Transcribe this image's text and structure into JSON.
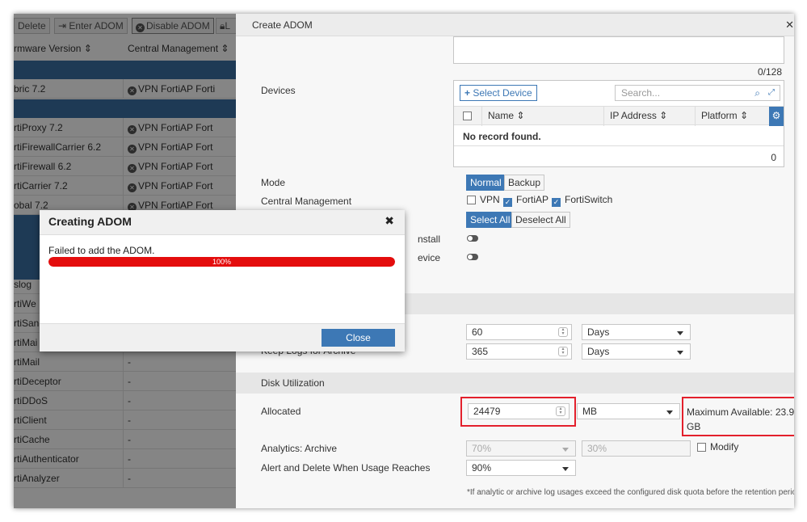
{
  "toolbar": {
    "delete": "Delete",
    "enter_adom": "Enter ADOM",
    "disable_adom": "Disable ADOM",
    "extra": "L"
  },
  "list": {
    "col_firmware": "rmware Version ⇕",
    "col_central": "Central Management ⇕",
    "rows": [
      {
        "name": "bric 7.2",
        "cm": "VPN  FortiAP  Forti"
      },
      {
        "name": "rtiProxy 7.2",
        "cm": "VPN  FortiAP  Fort"
      },
      {
        "name": "rtiFirewallCarrier 6.2",
        "cm": "VPN  FortiAP  Fort"
      },
      {
        "name": "rtiFirewall 6.2",
        "cm": "VPN  FortiAP  Fort"
      },
      {
        "name": "rtiCarrier 7.2",
        "cm": "VPN  FortiAP  Fort"
      },
      {
        "name": "obal 7.2",
        "cm": "VPN  FortiAP  Fort"
      },
      {
        "name": "slog",
        "cm": ""
      },
      {
        "name": "rtiWe",
        "cm": ""
      },
      {
        "name": "rtiSan",
        "cm": ""
      },
      {
        "name": "rtiMai",
        "cm": ""
      },
      {
        "name": "rtiMail",
        "cm": "-"
      },
      {
        "name": "rtiDeceptor",
        "cm": "-"
      },
      {
        "name": "rtiDDoS",
        "cm": "-"
      },
      {
        "name": "rtiClient",
        "cm": "-"
      },
      {
        "name": "rtiCache",
        "cm": "-"
      },
      {
        "name": "rtiAuthenticator",
        "cm": "-"
      },
      {
        "name": "rtiAnalyzer",
        "cm": "-"
      }
    ]
  },
  "panel": {
    "title": "Create ADOM",
    "char_count": "0/128",
    "devices_label": "Devices",
    "select_device": "Select Device",
    "search_placeholder": "Search...",
    "table_cols": [
      "Name ⇕",
      "IP Address ⇕",
      "Platform ⇕"
    ],
    "no_record": "No record found.",
    "record_count": "0",
    "mode_label": "Mode",
    "mode_normal": "Normal",
    "mode_backup": "Backup",
    "central_label": "Central Management",
    "cm_vpn": "VPN",
    "cm_fortiap": "FortiAP",
    "cm_fortiswitch": "FortiSwitch",
    "select_all": "Select All",
    "deselect_all": "Deselect All",
    "partial_install": "nstall",
    "partial_device": "evice",
    "keep_logs_label": "Keep Logs for Archive",
    "val_60": "60",
    "val_365": "365",
    "days1": "Days",
    "days2": "Days",
    "disk_section": "Disk Utilization",
    "allocated_label": "Allocated",
    "allocated_value": "24479",
    "unit": "MB",
    "max_available": "Maximum Available: 23.9 GB",
    "analytics_label": "Analytics: Archive",
    "analytics_value": "70%",
    "archive_value": "30%",
    "modify": "Modify",
    "alert_label": "Alert and Delete When Usage Reaches",
    "alert_value": "90%",
    "footnote": "*If analytic or archive log usages exceed the configured disk quota before the retention period"
  },
  "modal": {
    "title": "Creating ADOM",
    "message": "Failed to add the ADOM.",
    "progress": 100,
    "progress_label": "100%",
    "close_button": "Close"
  },
  "colors": {
    "accent": "#3d78b5",
    "error": "#e40d0d",
    "highlight": "#e3202c"
  }
}
